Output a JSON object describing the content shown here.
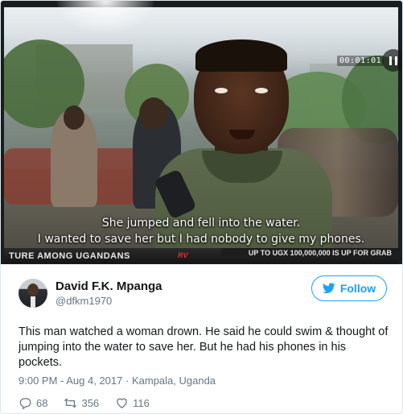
{
  "media": {
    "video_timer": "00:01:01",
    "subtitle_line1": "She jumped and fell into the water.",
    "subtitle_line2": "I wanted to save her but I had nobody to give my phones.",
    "ticker_left": "TURE AMONG UGANDANS",
    "ticker_logo": "RV",
    "ticker_right": "UP TO UGX 100,000,000 IS UP FOR GRAB"
  },
  "tweet": {
    "author_name": "David F.K. Mpanga",
    "author_handle": "@dfkm1970",
    "follow_label": "Follow",
    "text": "This man watched a woman drown. He said he could swim & thought of jumping into the water to save her. But he had his phones in his pockets.",
    "timestamp": "9:00 PM - Aug 4, 2017",
    "location": "Kampala, Uganda",
    "separator": "·",
    "replies": "68",
    "retweets": "356",
    "likes": "116"
  },
  "colors": {
    "twitter_blue": "#1da1f2",
    "meta_gray": "#657786",
    "text": "#14171a"
  },
  "icons": [
    "twitter-bird-icon",
    "reply-icon",
    "retweet-icon",
    "like-icon",
    "pause-icon"
  ]
}
